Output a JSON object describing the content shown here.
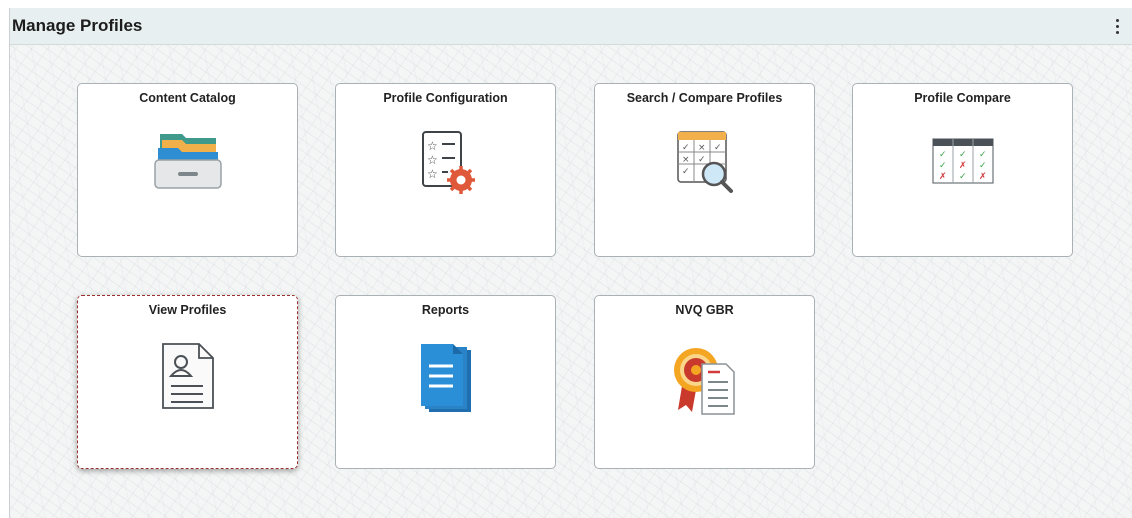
{
  "header": {
    "title": "Manage Profiles",
    "actions_icon": "kebab-menu-icon"
  },
  "tiles": [
    {
      "label": "Content Catalog",
      "icon": "folder-drawer-icon"
    },
    {
      "label": "Profile Configuration",
      "icon": "star-checklist-gear-icon"
    },
    {
      "label": "Search / Compare Profiles",
      "icon": "grid-magnifier-icon"
    },
    {
      "label": "Profile Compare",
      "icon": "compare-table-icon"
    },
    {
      "label": "View Profiles",
      "icon": "profile-document-icon"
    },
    {
      "label": "Reports",
      "icon": "stacked-report-icon"
    },
    {
      "label": "NVQ GBR",
      "icon": "award-ribbon-document-icon"
    }
  ],
  "colors": {
    "header_bg": "#e8eff0",
    "tile_border": "#a9b1b5",
    "focus_border": "#9b2f2f",
    "accent_blue": "#2b8fd8"
  }
}
